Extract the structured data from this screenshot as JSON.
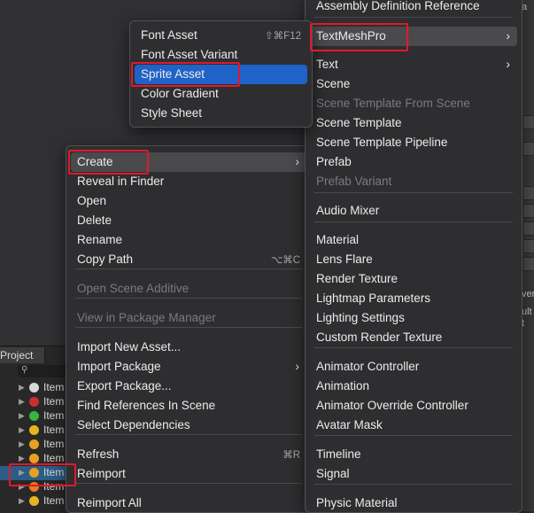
{
  "project_panel": {
    "tab_label": "Project",
    "search_icon": "search-icon",
    "items": [
      {
        "label": "Item",
        "color": "#d8d8d8"
      },
      {
        "label": "Item",
        "color": "#c9302c"
      },
      {
        "label": "Item",
        "color": "#3cb43c"
      },
      {
        "label": "Item",
        "color": "#e8b320"
      },
      {
        "label": "Item",
        "color": "#e8a020"
      },
      {
        "label": "Item",
        "color": "#e8a020"
      },
      {
        "label": "Item",
        "color": "#e8a020",
        "selected": true
      },
      {
        "label": "Item",
        "color": "#e87b20"
      },
      {
        "label": "Item",
        "color": "#e8b320"
      }
    ]
  },
  "right_strip": {
    "texts": [
      "a",
      "ver",
      "ult",
      "t"
    ]
  },
  "context_menu": {
    "items": [
      {
        "label": "Create",
        "submenu": true,
        "hover": true
      },
      {
        "label": "Reveal in Finder"
      },
      {
        "label": "Open"
      },
      {
        "label": "Delete"
      },
      {
        "label": "Rename"
      },
      {
        "label": "Copy Path",
        "shortcut": "⌥⌘C"
      },
      {
        "label": "Open Scene Additive",
        "disabled": true
      },
      {
        "label": "View in Package Manager",
        "disabled": true
      },
      {
        "label": "Import New Asset..."
      },
      {
        "label": "Import Package",
        "submenu": true
      },
      {
        "label": "Export Package..."
      },
      {
        "label": "Find References In Scene"
      },
      {
        "label": "Select Dependencies"
      },
      {
        "label": "Refresh",
        "shortcut": "⌘R"
      },
      {
        "label": "Reimport"
      },
      {
        "label": "Reimport All"
      }
    ]
  },
  "create_menu": {
    "items": [
      {
        "label": "Assembly Definition Reference"
      },
      {
        "label": "TextMeshPro",
        "submenu": true,
        "hover": true
      },
      {
        "label": "Text",
        "submenu": true
      },
      {
        "label": "Scene"
      },
      {
        "label": "Scene Template From Scene",
        "disabled": true
      },
      {
        "label": "Scene Template"
      },
      {
        "label": "Scene Template Pipeline"
      },
      {
        "label": "Prefab"
      },
      {
        "label": "Prefab Variant",
        "disabled": true
      },
      {
        "label": "Audio Mixer"
      },
      {
        "label": "Material"
      },
      {
        "label": "Lens Flare"
      },
      {
        "label": "Render Texture"
      },
      {
        "label": "Lightmap Parameters"
      },
      {
        "label": "Lighting Settings"
      },
      {
        "label": "Custom Render Texture"
      },
      {
        "label": "Animator Controller"
      },
      {
        "label": "Animation"
      },
      {
        "label": "Animator Override Controller"
      },
      {
        "label": "Avatar Mask"
      },
      {
        "label": "Timeline"
      },
      {
        "label": "Signal"
      },
      {
        "label": "Physic Material"
      }
    ]
  },
  "textmeshpro_menu": {
    "items": [
      {
        "label": "Font Asset",
        "shortcut": "⇧⌘F12"
      },
      {
        "label": "Font Asset Variant"
      },
      {
        "label": "Sprite Asset",
        "selected": true
      },
      {
        "label": "Color Gradient"
      },
      {
        "label": "Style Sheet"
      }
    ]
  },
  "highlight_color": "#e0192b"
}
